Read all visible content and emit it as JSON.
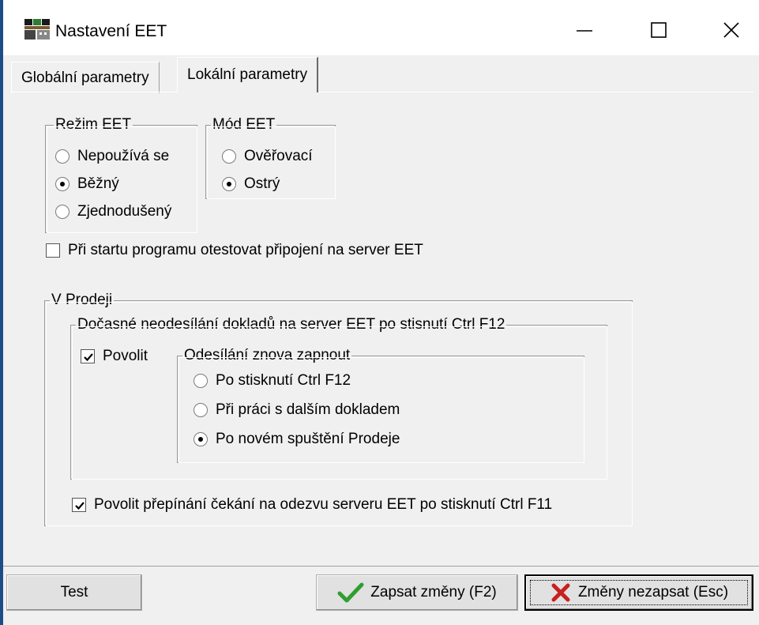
{
  "window": {
    "title": "Nastavení EET"
  },
  "tabs": [
    {
      "label": "Globální parametry"
    },
    {
      "label": "Lokální parametry"
    }
  ],
  "rezim": {
    "legend": "Režim EET",
    "options": [
      "Nepoužívá se",
      "Běžný",
      "Zjednodušený"
    ],
    "selected": "Běžný"
  },
  "mod": {
    "legend": "Mód EET",
    "options": [
      "Ověřovací",
      "Ostrý"
    ],
    "selected": "Ostrý"
  },
  "test_on_start": {
    "label": "Při startu programu otestovat připojení na server EET",
    "checked": false
  },
  "prodej": {
    "legend": "V Prodeji",
    "docasne": {
      "legend": "Dočasné neodesílání dokladů na server EET po stisnutí Ctrl F12",
      "povolit_label": "Povolit",
      "povolit_checked": true,
      "znova": {
        "legend": "Odesílání znova zapnout",
        "options": [
          "Po stisknutí Ctrl F12",
          "Při práci s dalším dokladem",
          "Po novém spuštění Prodeje"
        ],
        "selected": "Po novém spuštění Prodeje"
      }
    },
    "prepinani": {
      "label": "Povolit přepínání čekání na odezvu serveru EET po stisknutí Ctrl F11",
      "checked": true
    }
  },
  "buttons": {
    "test": "Test",
    "save": "Zapsat změny (F2)",
    "cancel": "Změny nezapsat (Esc)"
  },
  "colors": {
    "title_border": "#1d4d86",
    "check_icon": "#2f9e2f",
    "cross_icon": "#c8201e"
  }
}
